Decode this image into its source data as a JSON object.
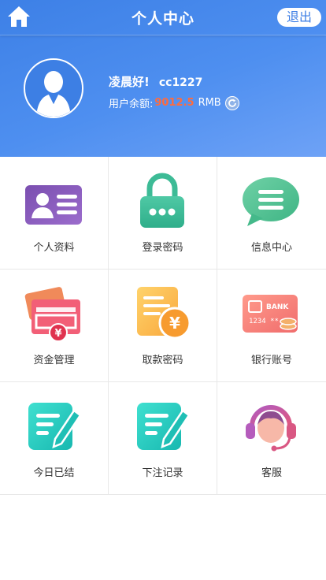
{
  "header": {
    "title": "个人中心",
    "logout_label": "退出"
  },
  "user": {
    "greeting": "凌晨好!",
    "username": "cc1227",
    "balance_label": "用户余额:",
    "balance_value": "9012.5",
    "currency": "RMB"
  },
  "menu": [
    {
      "label": "个人资料",
      "icon": "id-card-icon"
    },
    {
      "label": "登录密码",
      "icon": "lock-icon"
    },
    {
      "label": "信息中心",
      "icon": "chat-bubble-icon"
    },
    {
      "label": "资金管理",
      "icon": "wallet-icon"
    },
    {
      "label": "取款密码",
      "icon": "withdraw-document-icon"
    },
    {
      "label": "银行账号",
      "icon": "bank-card-icon"
    },
    {
      "label": "今日已结",
      "icon": "edit-note-icon"
    },
    {
      "label": "下注记录",
      "icon": "edit-note-icon"
    },
    {
      "label": "客服",
      "icon": "customer-service-icon"
    }
  ],
  "colors": {
    "header_blue": "#4a8aee",
    "balance_orange": "#ff6b3d"
  }
}
